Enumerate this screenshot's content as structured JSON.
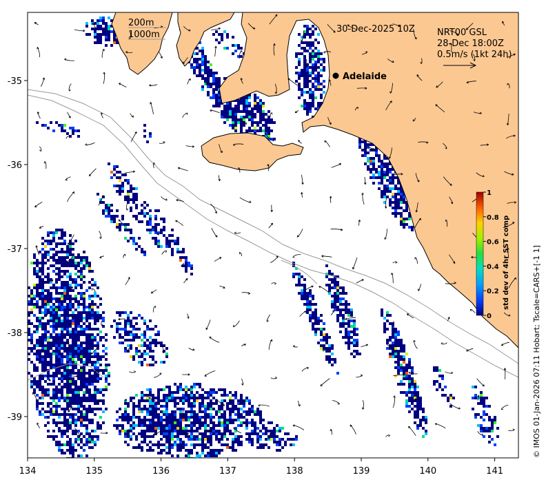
{
  "map": {
    "date_label": "30-Dec-2025 10Z",
    "product_label": "NRT00 GSL",
    "product_time": "28-Dec 18:00Z",
    "vector_scale_label": "0.5m/s (1kt 24h)",
    "isobath_labels": [
      "200m",
      "1000m"
    ],
    "city": {
      "name": "Adelaide",
      "lon": 138.6,
      "lat": -34.93
    },
    "credit": "© IMOS 01-Jan-2026 07:11 Hobart; Tscale=CARS+[-1 1]",
    "colors": {
      "land": "#fcc892",
      "sea": "#ffffff",
      "isobath": "#999999"
    }
  },
  "axes": {
    "x_ticks": [
      "134",
      "135",
      "136",
      "137",
      "138",
      "139",
      "140",
      "141"
    ],
    "y_ticks": [
      "-35",
      "-36",
      "-37",
      "-38",
      "-39"
    ],
    "xlim": [
      134,
      141.3
    ],
    "ylim": [
      -39.5,
      -34.2
    ]
  },
  "colorbar": {
    "title": "std dev of 4hr SST comp",
    "tick_labels": [
      "1",
      "0.8",
      "0.6",
      "0.4",
      "0.2",
      "0"
    ],
    "stops": [
      "#000080",
      "#0040ff",
      "#00c0ff",
      "#00e080",
      "#40ff00",
      "#c0ff00",
      "#ffd000",
      "#ff6000",
      "#c00000"
    ]
  }
}
